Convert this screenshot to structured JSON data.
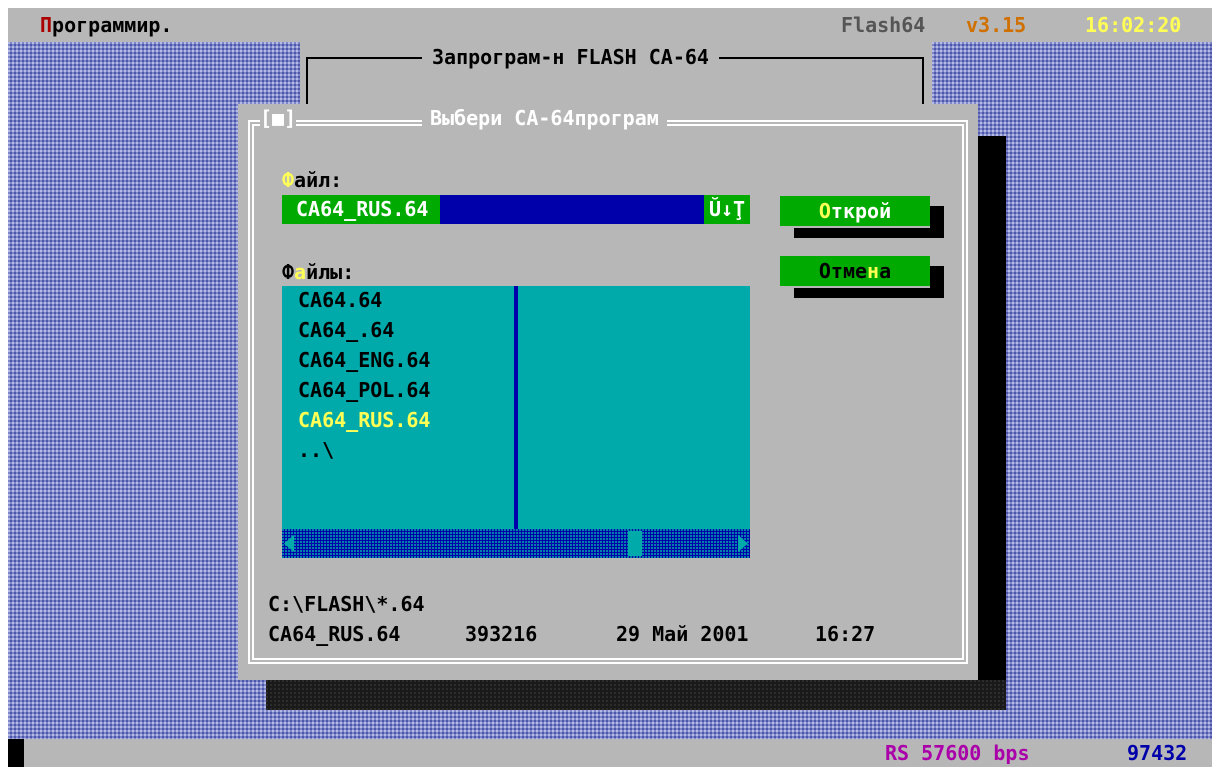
{
  "menubar": {
    "program_hot": "П",
    "program_rest": "рограммир.",
    "app_name": "Flash64",
    "version": "v3.15",
    "clock": "16:02:20"
  },
  "outer_dialog": {
    "title": "Запрограм-н FLASH CA-64"
  },
  "dialog": {
    "close": "[■]",
    "title": "Выбери CA-64програм",
    "file_label_hot": "Ф",
    "file_label_rest": "айл:",
    "file_value": "CA64_RUS.64",
    "history_icon": "Ŭ↓Ţ",
    "files_label_1": "Ф",
    "files_label_hot": "а",
    "files_label_2": "йлы:",
    "open_button_hot": "О",
    "open_button_rest": "ткрой",
    "cancel_button_1": "Отме",
    "cancel_button_hot": "н",
    "cancel_button_2": "а",
    "files": [
      "CA64.64",
      "CA64_.64",
      "CA64_ENG.64",
      "CA64_POL.64",
      "CA64_RUS.64",
      "..\\"
    ],
    "selected_index": 4,
    "path": "C:\\FLASH\\*.64",
    "info_name": "CA64_RUS.64",
    "info_size": "393216",
    "info_date": "29 Май 2001",
    "info_time": "16:27"
  },
  "statusbar": {
    "baud": "RS 57600 bps",
    "counter": "97432"
  },
  "colors": {
    "desktop": "#7c86c8",
    "window_gray": "#b7b7b7",
    "button_green": "#00aa00",
    "list_cyan": "#00aaaa",
    "input_blue": "#0000aa",
    "highlight_yellow": "#ffff55",
    "menu_red": "#aa0000",
    "version_orange": "#d07000",
    "status_magenta": "#aa00aa"
  }
}
